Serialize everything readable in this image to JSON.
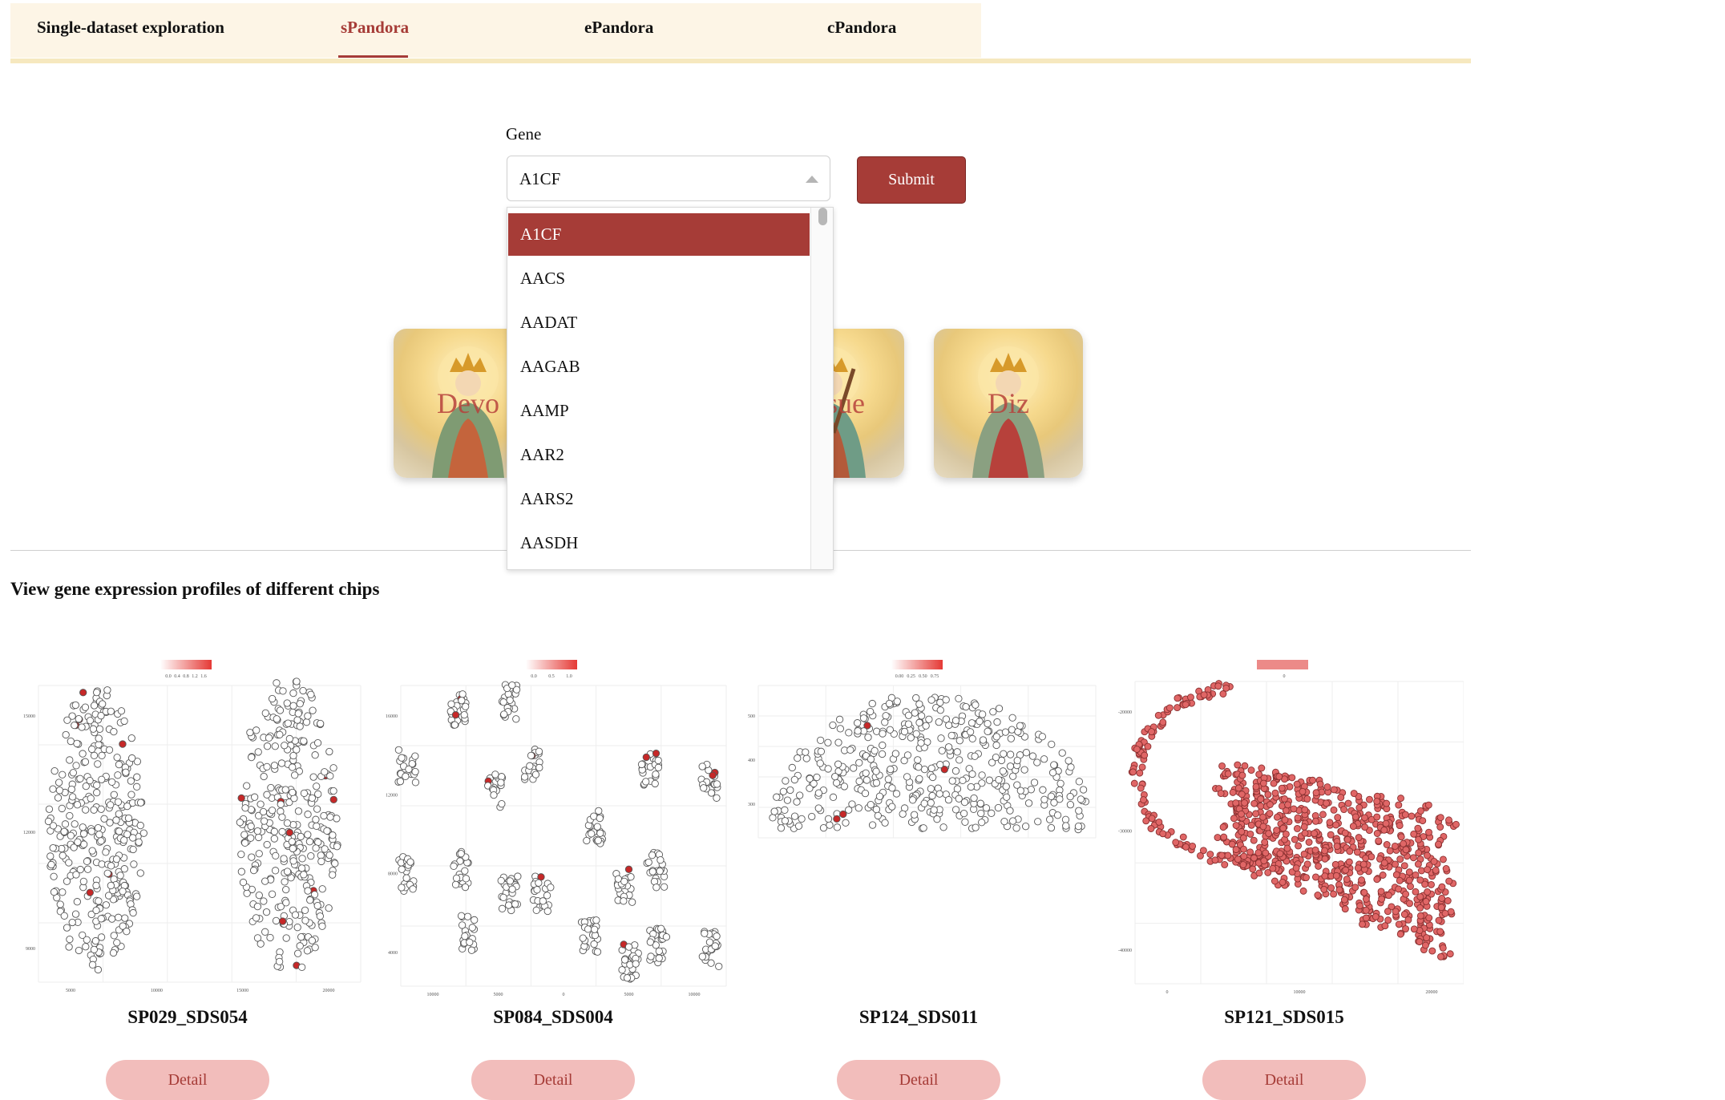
{
  "tabs": [
    {
      "label": "Single-dataset exploration",
      "active": false
    },
    {
      "label": "sPandora",
      "active": true
    },
    {
      "label": "ePandora",
      "active": false
    },
    {
      "label": "cPandora",
      "active": false
    }
  ],
  "form": {
    "gene_label": "Gene",
    "gene_value": "A1CF",
    "submit_label": "Submit"
  },
  "dropdown": {
    "options": [
      "A1CF",
      "AACS",
      "AADAT",
      "AAGAB",
      "AAMP",
      "AAR2",
      "AARS2",
      "AASDH"
    ],
    "selected": "A1CF"
  },
  "cards": [
    {
      "label": "Devo"
    },
    {
      "label": "sue"
    },
    {
      "label": "Diz"
    }
  ],
  "section": {
    "title": "View gene expression profiles of different chips"
  },
  "chips": [
    {
      "name": "SP029_SDS054",
      "detail_label": "Detail",
      "legend_ticks": [
        "0.0",
        "0.4",
        "0.8",
        "1.2",
        "1.6"
      ],
      "y_ticks": [
        "15000",
        "12000",
        "9000"
      ],
      "x_ticks": [
        "5000",
        "10000",
        "15000",
        "20000"
      ],
      "style": "white"
    },
    {
      "name": "SP084_SDS004",
      "detail_label": "Detail",
      "legend_ticks": [
        "0.0",
        "0.5",
        "1.0"
      ],
      "y_ticks": [
        "16000",
        "12000",
        "8000",
        "4000"
      ],
      "x_ticks": [
        "10000",
        "5000",
        "0",
        "5000",
        "10000"
      ],
      "style": "white"
    },
    {
      "name": "SP124_SDS011",
      "detail_label": "Detail",
      "legend_ticks": [
        "0.00",
        "0.25",
        "0.50",
        "0.75"
      ],
      "y_ticks": [
        "500",
        "400",
        "300"
      ],
      "x_ticks": [],
      "style": "white"
    },
    {
      "name": "SP121_SDS015",
      "detail_label": "Detail",
      "legend_ticks": [
        "0"
      ],
      "y_ticks": [
        "-20000",
        "-30000",
        "-40000"
      ],
      "x_ticks": [
        "0",
        "10000",
        "20000"
      ],
      "style": "red"
    }
  ],
  "colors": {
    "accent": "#a63c37",
    "tabbar": "#fdf5e6",
    "detail_bg": "#f2bdbb",
    "point_red": "#e06666"
  }
}
